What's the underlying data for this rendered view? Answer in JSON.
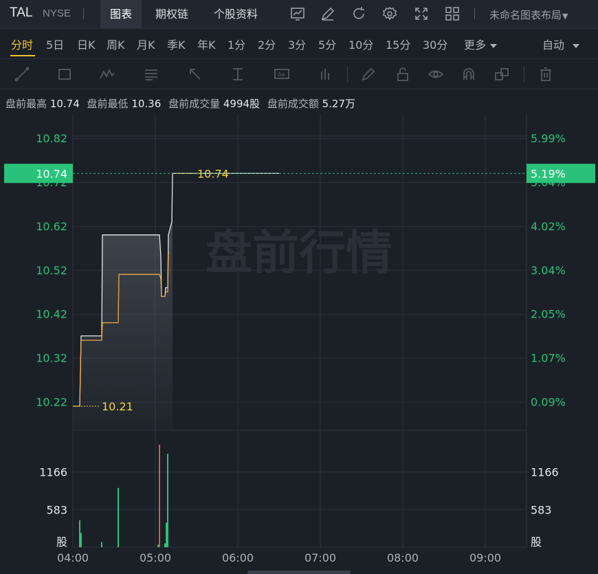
{
  "header": {
    "ticker": "TAL",
    "exchange": "NYSE",
    "tabs": [
      "图表",
      "期权链",
      "个股资料"
    ],
    "active_tab": "图表",
    "layout_name": "未命名图表布局"
  },
  "periods": {
    "items": [
      "分时",
      "5日",
      "日K",
      "周K",
      "月K",
      "季K",
      "年K",
      "1分",
      "2分",
      "3分",
      "5分",
      "10分",
      "15分",
      "30分",
      "更多"
    ],
    "active": "分时",
    "scale_mode": "自动"
  },
  "info": {
    "high_label": "盘前最高",
    "high_value": "10.74",
    "low_label": "盘前最低",
    "low_value": "10.36",
    "volume_label": "盘前成交量",
    "volume_value": "4994股",
    "turnover_label": "盘前成交额",
    "turnover_value": "5.27万"
  },
  "colors": {
    "up": "#2ac27a",
    "down": "#e05353",
    "price_line": "#e8e8e8",
    "avg_line": "#f0a84a",
    "label_yellow": "#f5d33a"
  },
  "chart_data": {
    "type": "line",
    "watermark": "盘前行情",
    "x_ticks": [
      "04:00",
      "05:00",
      "06:00",
      "07:00",
      "08:00",
      "09:00"
    ],
    "x_range_minutes": [
      0,
      330
    ],
    "price_ticks": [
      "10.82",
      "10.72",
      "10.62",
      "10.52",
      "10.42",
      "10.32",
      "10.22"
    ],
    "price_tick_values": [
      10.82,
      10.72,
      10.62,
      10.52,
      10.42,
      10.32,
      10.22
    ],
    "pct_ticks": [
      "5.99%",
      "5.04%",
      "4.02%",
      "3.04%",
      "2.05%",
      "1.07%",
      "0.09%"
    ],
    "ylim": [
      10.155,
      10.875
    ],
    "current_price": "10.74",
    "current_pct": "5.19%",
    "max_label": "10.74",
    "min_label": "10.21",
    "price_series": {
      "x": [
        0,
        5,
        6,
        21,
        21.5,
        63,
        64,
        64.5,
        67,
        67.5,
        69,
        69.5,
        72,
        72.5,
        150
      ],
      "y": [
        10.21,
        10.21,
        10.37,
        10.37,
        10.6,
        10.6,
        10.55,
        10.46,
        10.46,
        10.48,
        10.48,
        10.6,
        10.63,
        10.74,
        10.74
      ]
    },
    "avg_series": {
      "x": [
        0,
        5,
        6,
        21,
        21.5,
        33,
        33.5,
        63,
        64,
        64.5,
        67,
        67.5,
        69,
        69.5,
        70
      ],
      "y": [
        10.21,
        10.21,
        10.36,
        10.36,
        10.4,
        10.4,
        10.51,
        10.51,
        10.5,
        10.46,
        10.46,
        10.47,
        10.47,
        10.56,
        10.56
      ]
    },
    "volume_ticks": [
      "1166",
      "583",
      "股"
    ],
    "volume_tick_values": [
      1166,
      583,
      0
    ],
    "volume_max": 1750,
    "volume_bars": [
      {
        "x": 5,
        "v": 420,
        "dir": "up"
      },
      {
        "x": 6,
        "v": 220,
        "dir": "up"
      },
      {
        "x": 21,
        "v": 80,
        "dir": "up"
      },
      {
        "x": 33,
        "v": 920,
        "dir": "up"
      },
      {
        "x": 62,
        "v": 40,
        "dir": "up"
      },
      {
        "x": 63,
        "v": 1590,
        "dir": "down"
      },
      {
        "x": 67,
        "v": 60,
        "dir": "up"
      },
      {
        "x": 68,
        "v": 380,
        "dir": "up"
      },
      {
        "x": 69,
        "v": 1450,
        "dir": "up"
      }
    ]
  }
}
